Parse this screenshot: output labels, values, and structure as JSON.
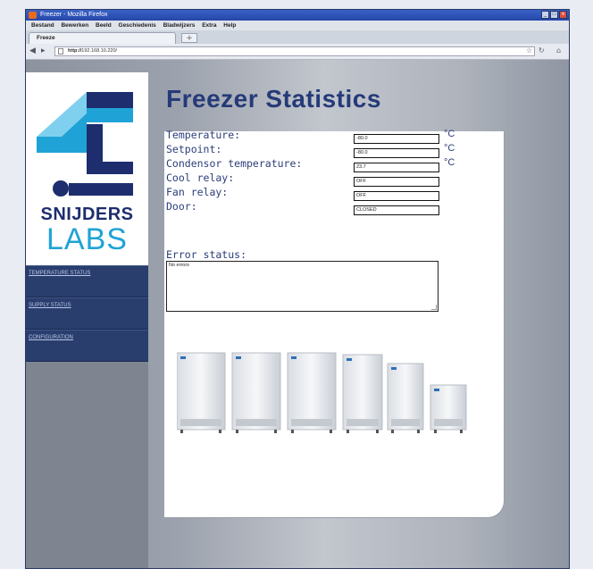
{
  "browser": {
    "window_title": "Freezer - Mozilla Firefox",
    "menu": [
      "Bestand",
      "Bewerken",
      "Beeld",
      "Geschiedenis",
      "Bladwijzers",
      "Extra",
      "Help"
    ],
    "tab_title": "Freeze",
    "url_prefix": "http://",
    "url": "192.168.10.220/"
  },
  "brand": {
    "line1": "SNIJDERS",
    "line2": "LABS",
    "colors": {
      "navy": "#1d2d6e",
      "blue": "#1fa3d6",
      "lightblue": "#7fd0ef"
    }
  },
  "nav": [
    {
      "label": "TEMPERATURE STATUS"
    },
    {
      "label": "SUPPLY STATUS"
    },
    {
      "label": "CONFIGURATION"
    }
  ],
  "page": {
    "title": "Freezer Statistics",
    "fields": [
      {
        "label": "Temperature:",
        "value": "-80.0",
        "unit": "°C"
      },
      {
        "label": "Setpoint:",
        "value": "-80.0",
        "unit": "°C"
      },
      {
        "label": "Condensor temperature:",
        "value": "23.7",
        "unit": "°C"
      },
      {
        "label": "Cool relay:",
        "value": "OFF",
        "unit": ""
      },
      {
        "label": "Fan relay:",
        "value": "OFF",
        "unit": ""
      },
      {
        "label": "Door:",
        "value": "CLOSED",
        "unit": ""
      }
    ],
    "error_label": "Error status:",
    "error_text": "No errors"
  }
}
